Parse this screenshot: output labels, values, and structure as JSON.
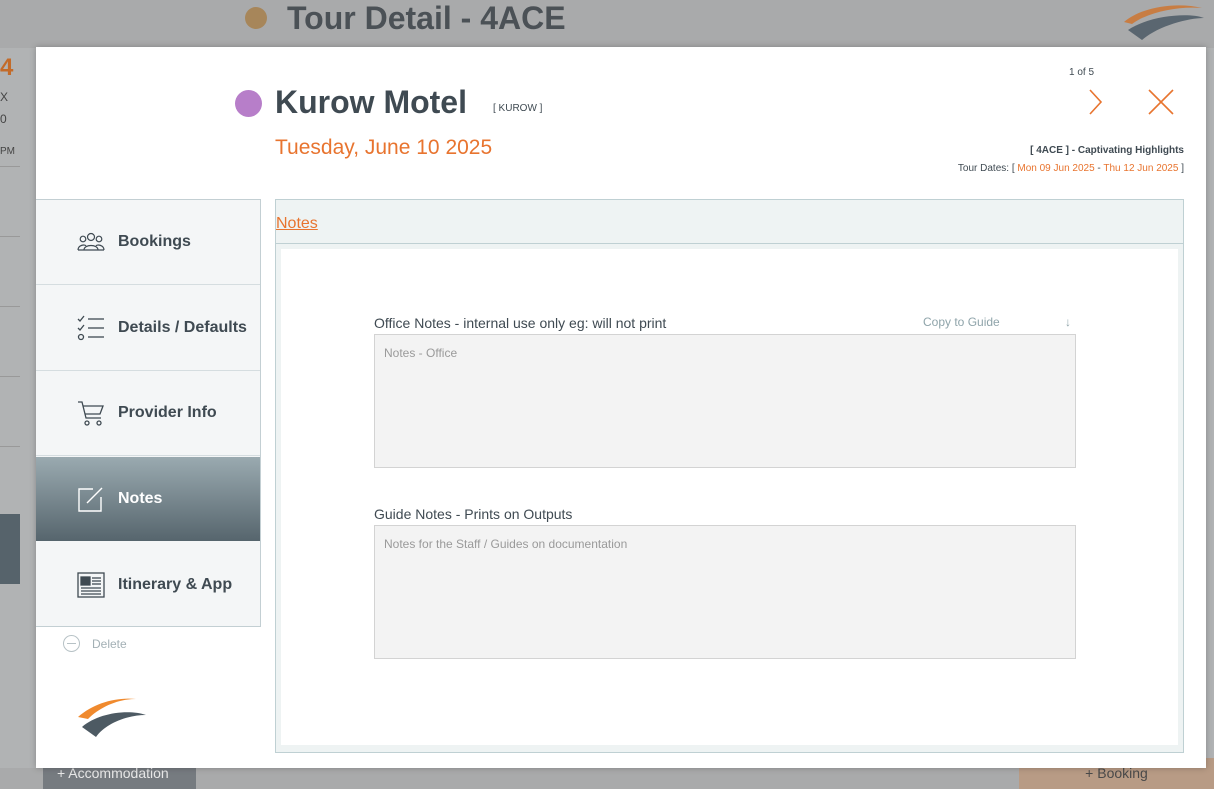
{
  "background": {
    "title": "Tour Detail - 4ACE",
    "left_fragments": [
      "4",
      "X",
      "0",
      "PM"
    ],
    "accommodation_button": "Accommodation",
    "booking_button": "Booking"
  },
  "modal": {
    "provider_name": "Kurow Motel",
    "provider_code": "[ KUROW ]",
    "date": "Tuesday, June 10 2025",
    "pager": "1 of 5",
    "tour": {
      "line": "[ 4ACE ] - Captivating Highlights",
      "dates_prefix": "Tour Dates: [ ",
      "start": "Mon 09 Jun 2025",
      "separator": " - ",
      "end": "Thu 12 Jun 2025",
      "dates_suffix": " ]"
    },
    "colors": {
      "provider_dot": "#b77ec9",
      "accent": "#e8742f",
      "active_tab": "#56656d"
    }
  },
  "nav": {
    "items": [
      {
        "label": "Bookings",
        "icon": "people-icon"
      },
      {
        "label": "Details / Defaults",
        "icon": "checklist-icon"
      },
      {
        "label": "Provider Info",
        "icon": "cart-icon"
      },
      {
        "label": "Notes",
        "icon": "edit-note-icon",
        "active": true
      },
      {
        "label": "Itinerary & App",
        "icon": "newspaper-icon"
      }
    ],
    "delete_label": "Delete"
  },
  "notes": {
    "panel_title": "Notes",
    "office": {
      "label": "Office Notes - internal use only eg: will not print",
      "placeholder": "Notes - Office",
      "value": ""
    },
    "copy_to_guide": "Copy to Guide",
    "copy_arrow": "↓",
    "guide": {
      "label": "Guide Notes - Prints on Outputs",
      "placeholder": "Notes for the Staff / Guides on documentation",
      "value": ""
    }
  }
}
